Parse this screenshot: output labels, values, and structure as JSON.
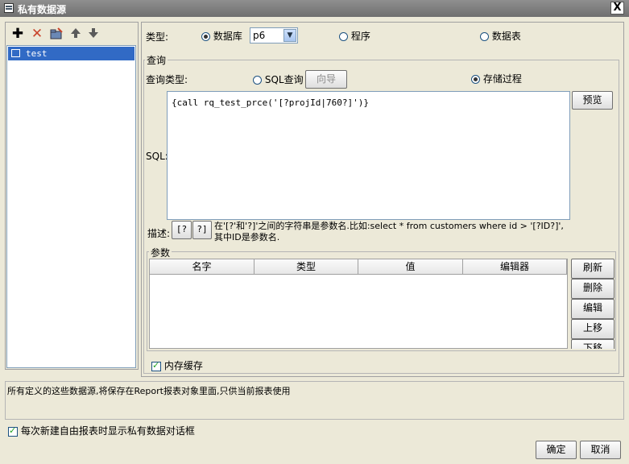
{
  "window": {
    "title": "私有数据源",
    "close_label": "X"
  },
  "toolbar": {
    "add_icon": "plus-icon",
    "delete_icon": "delete-x-icon",
    "edit_icon": "folder-edit-icon",
    "up_icon": "arrow-up-icon",
    "down_icon": "arrow-down-icon"
  },
  "datasource_list": {
    "items": [
      {
        "label": "test",
        "selected": true
      }
    ]
  },
  "type_row": {
    "label": "类型:",
    "options": [
      {
        "label": "数据库",
        "selected": true
      },
      {
        "label": "程序",
        "selected": false
      },
      {
        "label": "数据表",
        "selected": false
      }
    ],
    "db_select_value": "p6"
  },
  "query": {
    "group_label": "查询",
    "type_label": "查询类型:",
    "sql_option_label": "SQL查询",
    "wizard_button": "向导",
    "proc_option_label": "存储过程",
    "preview_button": "预览",
    "sql_label": "SQL:",
    "sql_text": "{call rq_test_prce('[?projId|760?]')}",
    "desc_label": "描述:",
    "desc_btn1": "[?",
    "desc_btn2": "?]",
    "desc_text_line1": "在'[?'和'?]'之间的字符串是参数名.比如:select * from customers where id > '[?ID?]',",
    "desc_text_line2": "其中ID是参数名."
  },
  "params": {
    "group_label": "参数",
    "columns": [
      "名字",
      "类型",
      "值",
      "编辑器"
    ],
    "rows": [],
    "buttons": {
      "refresh": "刷新",
      "delete": "删除",
      "edit": "编辑",
      "move_up": "上移",
      "move_down": "下移"
    }
  },
  "memory_cache": {
    "label": "内存缓存",
    "checked": true
  },
  "info_text": "所有定义的这些数据源,将保存在Report报表对象里面,只供当前报表使用",
  "show_dialog": {
    "label": "每次新建自由报表时显示私有数据对话框",
    "checked": true
  },
  "footer": {
    "ok": "确定",
    "cancel": "取消"
  }
}
